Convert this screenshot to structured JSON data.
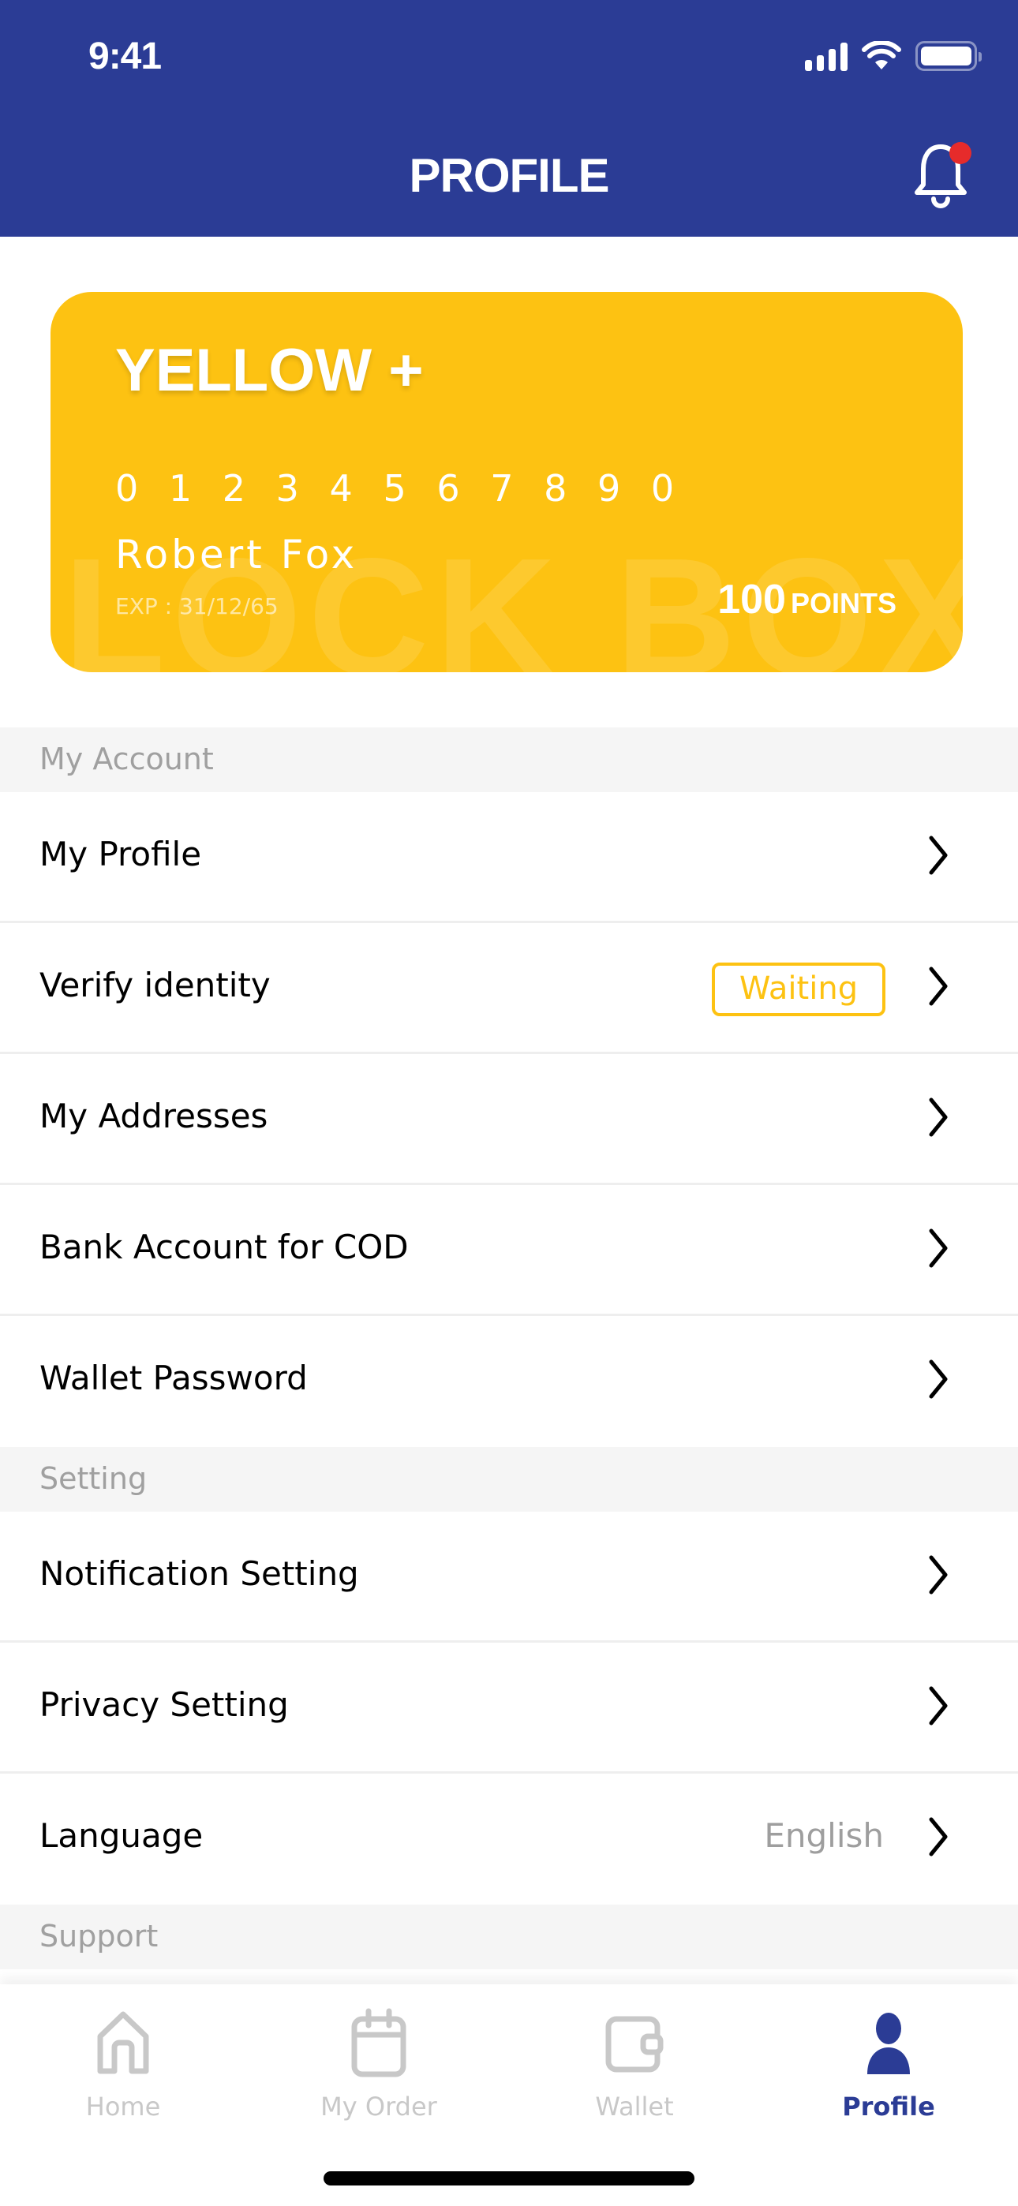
{
  "status_bar": {
    "time": "9:41"
  },
  "header": {
    "title": "PROFILE",
    "notification_badge": true
  },
  "colors": {
    "primary": "#2B3C95",
    "accent": "#FDC212",
    "badge_red": "#E62B2B",
    "muted": "#9E9E9E"
  },
  "card": {
    "tier": "YELLOW +",
    "number": "0 1 2 3 4 5 6 7 8 9 0",
    "name": "Robert Fox",
    "expiry": "EXP : 31/12/65",
    "points": "100",
    "points_unit": "POINTS",
    "watermark": "LOCK BOX"
  },
  "sections": [
    {
      "title": "My Account",
      "items": [
        {
          "label": "My Profile"
        },
        {
          "label": "Verify identity",
          "badge": "Waiting"
        },
        {
          "label": "My Addresses"
        },
        {
          "label": "Bank Account for COD"
        },
        {
          "label": "Wallet Password"
        }
      ]
    },
    {
      "title": "Setting",
      "items": [
        {
          "label": "Notification Setting"
        },
        {
          "label": "Privacy Setting"
        },
        {
          "label": "Language",
          "value": "English"
        }
      ]
    },
    {
      "title": "Support",
      "items": []
    }
  ],
  "tabbar": {
    "tabs": [
      {
        "label": "Home",
        "icon": "home-icon",
        "active": false
      },
      {
        "label": "My Order",
        "icon": "calendar-icon",
        "active": false
      },
      {
        "label": "Wallet",
        "icon": "wallet-icon",
        "active": false
      },
      {
        "label": "Profile",
        "icon": "person-icon",
        "active": true
      }
    ]
  }
}
